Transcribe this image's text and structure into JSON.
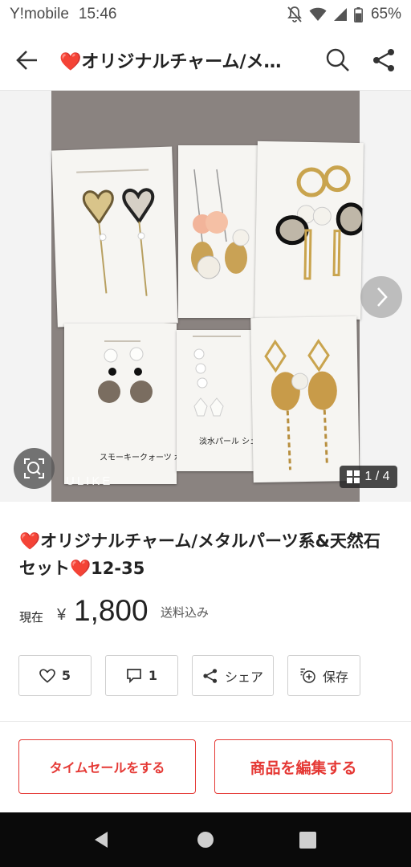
{
  "status_bar": {
    "carrier": "Y!mobile",
    "time": "15:46",
    "battery": "65%"
  },
  "app_bar": {
    "title": "❤️オリジナルチャーム/メ…",
    "icons": [
      "back-arrow-icon",
      "search-icon",
      "share-icon"
    ]
  },
  "gallery": {
    "counter": "1 / 4",
    "watermark": "ULIKE",
    "card_notes": [
      "スモーキークォーツ 水晶 オニキス",
      "淡水パール シェル"
    ]
  },
  "product": {
    "title_text": "オリジナルチャーム/メタルパーツ系&天然石セット",
    "title_suffix": "12-35",
    "heart": "❤️",
    "price_label": "現在",
    "currency": "¥",
    "price": "1,800",
    "shipping": "送料込み"
  },
  "actions": {
    "like_count": "5",
    "comment_count": "1",
    "share_label": "シェア",
    "save_label": "保存"
  },
  "buttons": {
    "time_sale": "タイムセールをする",
    "edit_item": "商品を編集する"
  },
  "colors": {
    "accent": "#e53935",
    "nav_bar": "#0a0a0a"
  }
}
